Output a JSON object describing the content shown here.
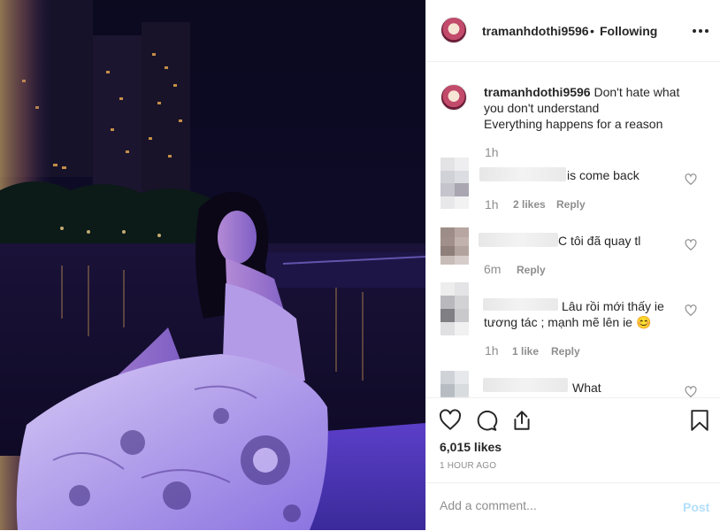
{
  "header": {
    "username": "tramanhdothi9596",
    "separator": "•",
    "follow_status": "Following",
    "more_icon": "more-options-icon"
  },
  "caption": {
    "username": "tramanhdothi9596",
    "line1": "Don't hate what",
    "line2": "you don't understand",
    "line3": "Everything happens for a reason",
    "time": "1h"
  },
  "comments": [
    {
      "text": "is come back",
      "time": "1h",
      "likes": "2 likes",
      "reply": "Reply"
    },
    {
      "text": "C tôi đã quay tl",
      "time": "6m",
      "reply": "Reply"
    },
    {
      "line1": "Lâu rồi mới thấy ie",
      "line2": "tương tác ; mạnh mẽ lên ie",
      "emoji": "😊",
      "time": "1h",
      "likes": "1 like",
      "reply": "Reply"
    },
    {
      "text": "What"
    }
  ],
  "actions": {
    "likes": "6,015 likes",
    "posted": "1 HOUR AGO",
    "icons": [
      "heart-icon",
      "comment-icon",
      "share-icon",
      "bookmark-icon"
    ]
  },
  "add_comment": {
    "placeholder": "Add a comment...",
    "post_label": "Post",
    "post_color": "#b2dffc"
  },
  "colors": {
    "text": "#262626",
    "secondary": "#8e8e8e",
    "divider": "#efefef"
  }
}
